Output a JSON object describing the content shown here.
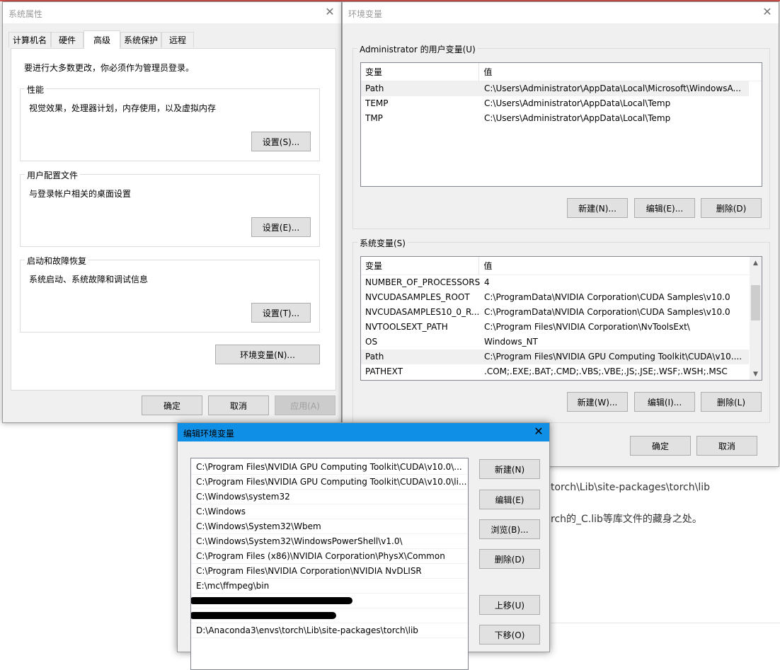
{
  "background": {
    "line1": "torch\\Lib\\site-packages\\torch\\lib",
    "line2": "rch的_C.lib等库文件的藏身之处。"
  },
  "sysprops": {
    "title": "系统属性",
    "tabs": [
      "计算机名",
      "硬件",
      "高级",
      "系统保护",
      "远程"
    ],
    "admin_note": "要进行大多数更改，你必须作为管理员登录。",
    "groups": {
      "performance": {
        "label": "性能",
        "desc": "视觉效果，处理器计划，内存使用，以及虚拟内存",
        "button": "设置(S)..."
      },
      "profile": {
        "label": "用户配置文件",
        "desc": "与登录帐户相关的桌面设置",
        "button": "设置(E)..."
      },
      "startup": {
        "label": "启动和故障恢复",
        "desc": "系统启动、系统故障和调试信息",
        "button": "设置(T)..."
      }
    },
    "env_button": "环境变量(N)...",
    "ok": "确定",
    "cancel": "取消",
    "apply": "应用(A)"
  },
  "envvars": {
    "title": "环境变量",
    "user_group": "Administrator 的用户变量(U)",
    "sys_group": "系统变量(S)",
    "col_var": "变量",
    "col_val": "值",
    "user_rows": [
      {
        "name": "Path",
        "value": "C:\\Users\\Administrator\\AppData\\Local\\Microsoft\\WindowsA..."
      },
      {
        "name": "TEMP",
        "value": "C:\\Users\\Administrator\\AppData\\Local\\Temp"
      },
      {
        "name": "TMP",
        "value": "C:\\Users\\Administrator\\AppData\\Local\\Temp"
      }
    ],
    "sys_rows": [
      {
        "name": "NUMBER_OF_PROCESSORS",
        "value": "4"
      },
      {
        "name": "NVCUDASAMPLES_ROOT",
        "value": "C:\\ProgramData\\NVIDIA Corporation\\CUDA Samples\\v10.0"
      },
      {
        "name": "NVCUDASAMPLES10_0_R...",
        "value": "C:\\ProgramData\\NVIDIA Corporation\\CUDA Samples\\v10.0"
      },
      {
        "name": "NVTOOLSEXT_PATH",
        "value": "C:\\Program Files\\NVIDIA Corporation\\NvToolsExt\\"
      },
      {
        "name": "OS",
        "value": "Windows_NT"
      },
      {
        "name": "Path",
        "value": "C:\\Program Files\\NVIDIA GPU Computing Toolkit\\CUDA\\v10...."
      },
      {
        "name": "PATHEXT",
        "value": ".COM;.EXE;.BAT;.CMD;.VBS;.VBE;.JS;.JSE;.WSF;.WSH;.MSC"
      }
    ],
    "user_buttons": {
      "new": "新建(N)...",
      "edit": "编辑(E)...",
      "delete": "删除(D)"
    },
    "sys_buttons": {
      "new": "新建(W)...",
      "edit": "编辑(I)...",
      "delete": "删除(L)"
    },
    "ok": "确定",
    "cancel": "取消"
  },
  "editenv": {
    "title": "编辑环境变量",
    "items": [
      "C:\\Program Files\\NVIDIA GPU Computing Toolkit\\CUDA\\v10.0\\...",
      "C:\\Program Files\\NVIDIA GPU Computing Toolkit\\CUDA\\v10.0\\li...",
      "C:\\Windows\\system32",
      "C:\\Windows",
      "C:\\Windows\\System32\\Wbem",
      "C:\\Windows\\System32\\WindowsPowerShell\\v1.0\\",
      "C:\\Program Files (x86)\\NVIDIA Corporation\\PhysX\\Common",
      "C:\\Program Files\\NVIDIA Corporation\\NVIDIA NvDLISR",
      "E:\\mc\\ffmpeg\\bin",
      "",
      "",
      "D:\\Anaconda3\\envs\\torch\\Lib\\site-packages\\torch\\lib"
    ],
    "buttons": {
      "new": "新建(N)",
      "edit": "编辑(E)",
      "browse": "浏览(B)...",
      "delete": "删除(D)",
      "up": "上移(U)",
      "down": "下移(O)"
    }
  }
}
